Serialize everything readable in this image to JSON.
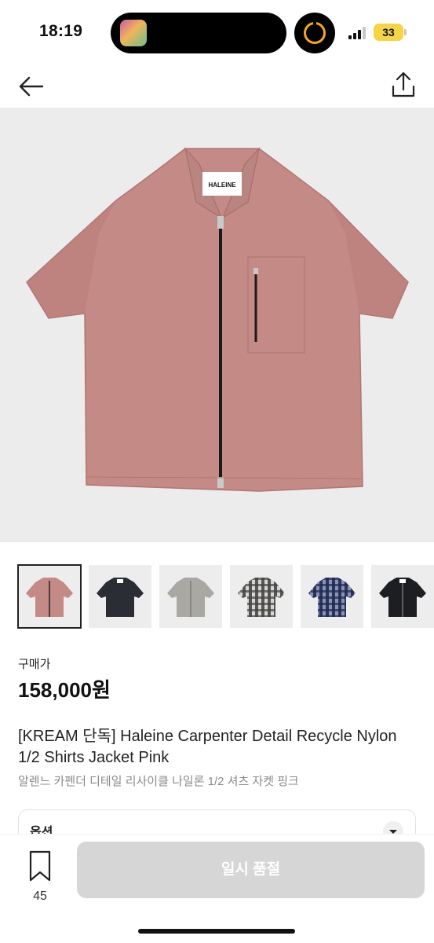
{
  "status": {
    "time": "18:19",
    "battery": "33"
  },
  "header": {
    "back_icon": "arrow-left-icon",
    "share_icon": "share-icon"
  },
  "product": {
    "brand_tag": "HALEINE",
    "main_image_color": "#c48a86",
    "thumbnails": [
      {
        "color": "#c48a86",
        "pattern": "solid",
        "selected": true
      },
      {
        "color": "#2a2d34",
        "pattern": "solid",
        "selected": false
      },
      {
        "color": "#a9a8a2",
        "pattern": "solid",
        "selected": false
      },
      {
        "color": "#6b6b6b",
        "pattern": "check",
        "selected": false
      },
      {
        "color": "#3d4a72",
        "pattern": "check",
        "selected": false
      },
      {
        "color": "#1d1e22",
        "pattern": "solid",
        "selected": false
      }
    ],
    "price_label": "구매가",
    "price": "158,000원",
    "title": "[KREAM 단독] Haleine Carpenter Detail Recycle Nylon 1/2 Shirts Jacket Pink",
    "subtitle": "알렌느 카펜더 디테일 리사이클 나일론 1/2 셔츠 자켓 핑크"
  },
  "option": {
    "label": "옵션"
  },
  "bottom_bar": {
    "wish_count": "45",
    "soldout_label": "일시 품절"
  }
}
